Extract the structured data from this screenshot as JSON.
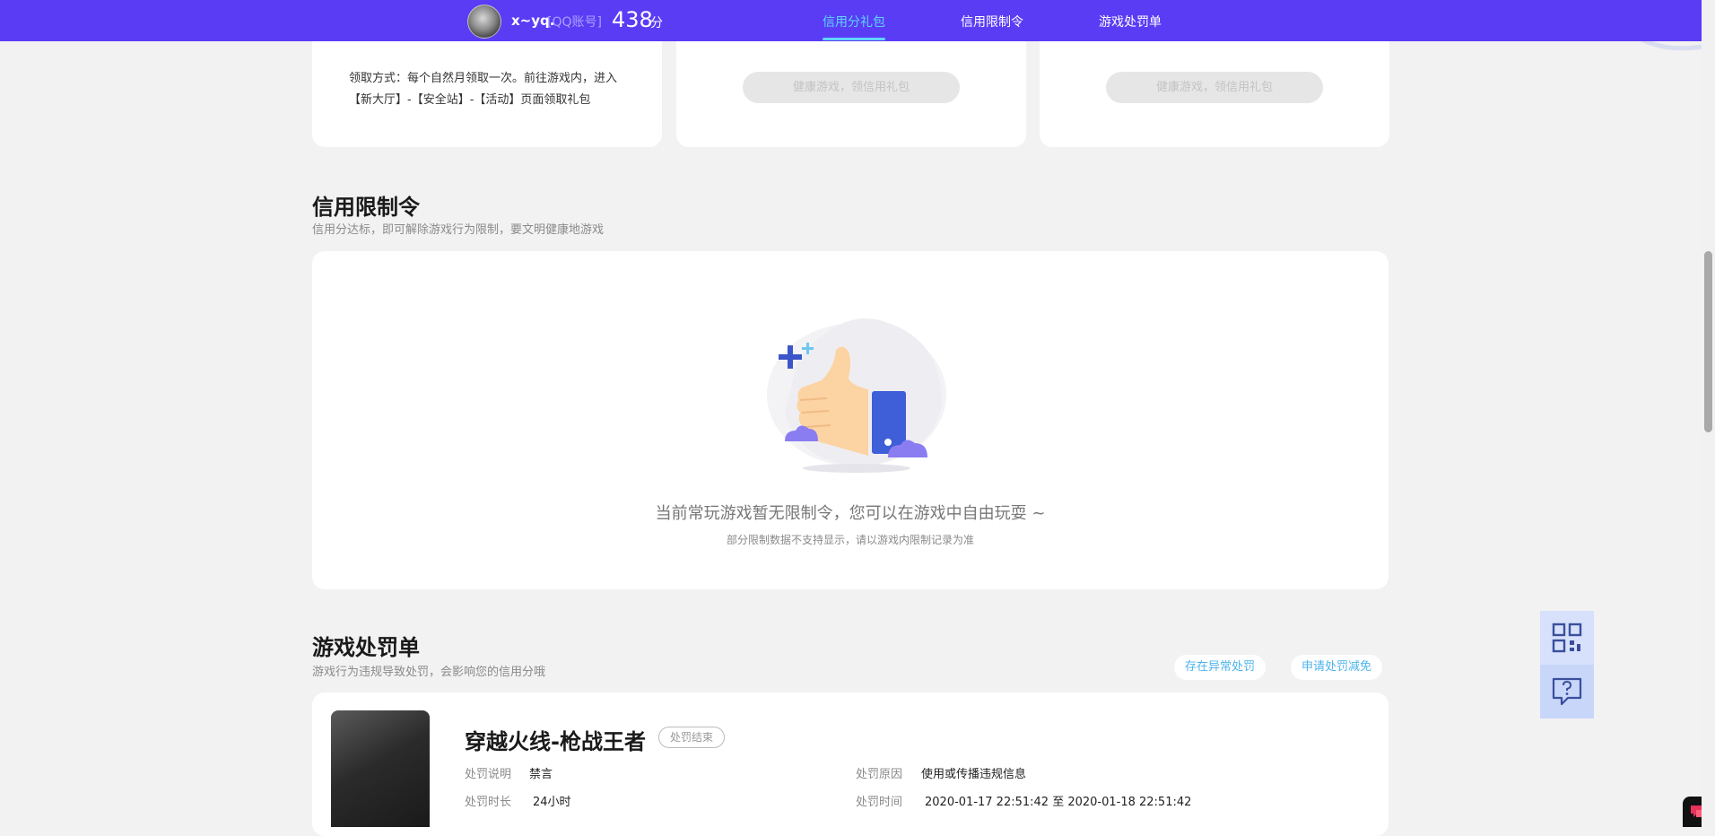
{
  "header": {
    "username": "x~yq.",
    "account_type": "[QQ账号]",
    "score": "438",
    "score_unit": "分",
    "tabs": [
      {
        "label": "信用分礼包",
        "active": true
      },
      {
        "label": "信用限制令",
        "active": false
      },
      {
        "label": "游戏处罚单",
        "active": false
      }
    ]
  },
  "gift_cards": {
    "claim_text": "领取方式：每个自然月领取一次。前往游戏内，进入【新大厅】-【安全站】-【活动】页面领取礼包",
    "button_label_1": "健康游戏，领信用礼包",
    "button_label_2": "健康游戏，领信用礼包"
  },
  "restriction_section": {
    "title": "信用限制令",
    "subtitle": "信用分达标，即可解除游戏行为限制，要文明健康地游戏",
    "empty_message": "当前常玩游戏暂无限制令，您可以在游戏中自由玩耍 ~",
    "empty_note": "部分限制数据不支持显示，请以游戏内限制记录为准"
  },
  "penalty_section": {
    "title": "游戏处罚单",
    "subtitle": "游戏行为违规导致处罚，会影响您的信用分哦",
    "btn_abnormal": "存在异常处罚",
    "btn_reduce": "申请处罚减免",
    "item": {
      "game_name": "穿越火线-枪战王者",
      "status": "处罚结束",
      "desc_label": "处罚说明",
      "desc_value": "禁言",
      "duration_label": "处罚时长",
      "duration_value": "24小时",
      "reason_label": "处罚原因",
      "reason_value": "使用或传播违规信息",
      "time_label": "处罚时间",
      "time_value": "2020-01-17 22:51:42 至 2020-01-18 22:51:42"
    }
  },
  "colors": {
    "brand": "#5a3cf5",
    "active_tab": "#5fd4ff",
    "link": "#4cb4ec"
  }
}
